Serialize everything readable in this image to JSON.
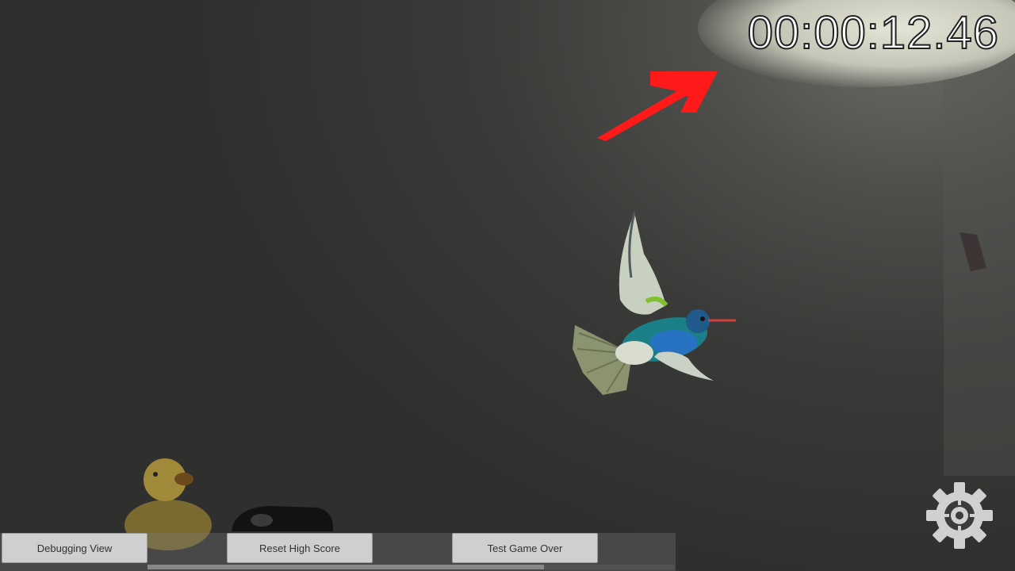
{
  "hud": {
    "timer": "00:00:12.46",
    "timer_color": "#ffffff",
    "arrow_color": "#ff1a1a"
  },
  "debug_panel": {
    "buttons": [
      {
        "label": "Debugging View"
      },
      {
        "label": "Reset High Score"
      },
      {
        "label": "Test Game Over"
      }
    ]
  },
  "settings": {
    "icon": "gear-icon",
    "color": "#d0d0d0"
  },
  "scene": {
    "subject": "hummingbird"
  }
}
